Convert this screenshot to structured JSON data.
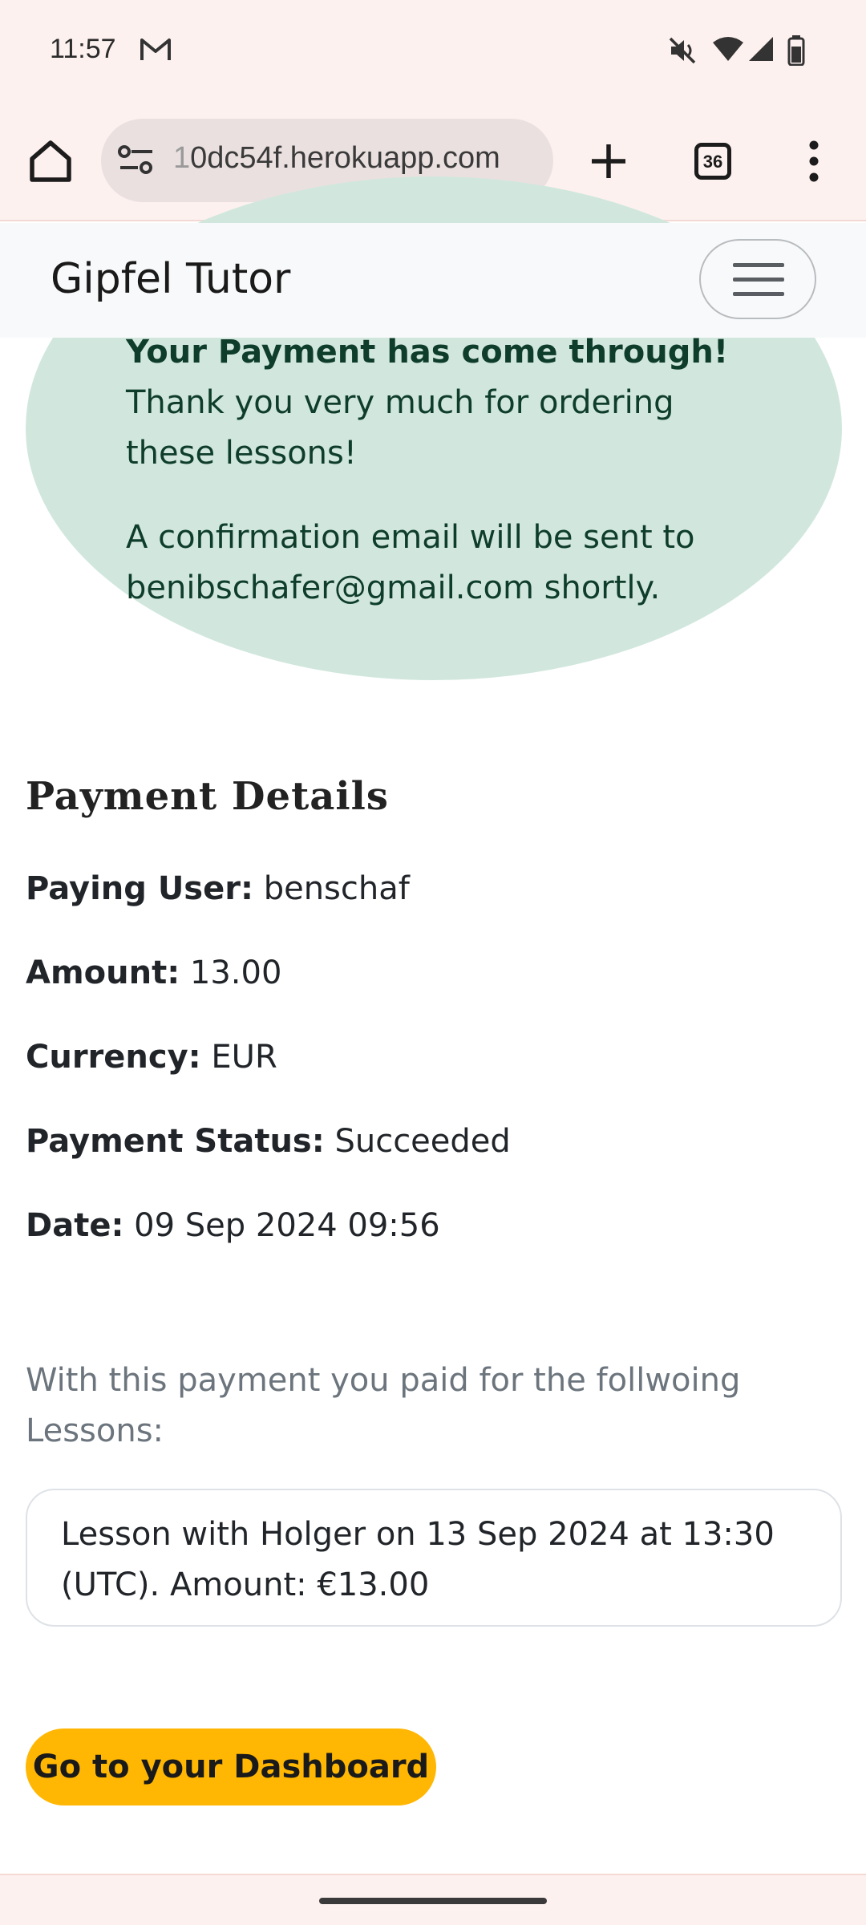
{
  "status_bar": {
    "time": "11:57",
    "icons": [
      "gmail-icon",
      "mute-icon",
      "wifi-icon",
      "signal-icon",
      "battery-icon"
    ]
  },
  "browser": {
    "url_prefix": "1",
    "url_main": "0dc54f.herokuapp.com",
    "tab_count": "36",
    "icons": [
      "home-icon",
      "site-info-icon",
      "new-tab-icon",
      "tab-switcher-icon",
      "more-icon"
    ]
  },
  "navbar": {
    "brand": "Gipfel Tutor"
  },
  "alert": {
    "heading": "Your Payment has come through!",
    "message": "Thank you very much for ordering these lessons!",
    "email_note": "A confirmation email will be sent to benibschafer@gmail.com shortly."
  },
  "details": {
    "title": "Payment Details",
    "paying_user_label": "Paying User:",
    "paying_user": "benschaf",
    "amount_label": "Amount:",
    "amount": "13.00",
    "currency_label": "Currency:",
    "currency": "EUR",
    "status_label": "Payment Status:",
    "status": "Succeeded",
    "date_label": "Date:",
    "date": "09 Sep 2024 09:56"
  },
  "lessons": {
    "intro": "With this payment you paid for the follwoing Lessons:",
    "items": [
      "Lesson with Holger on 13 Sep 2024 at 13:30 (UTC). Amount: €13.00"
    ]
  },
  "actions": {
    "dashboard_button": "Go to your Dashboard"
  },
  "colors": {
    "alert_bg": "#d1e7dd",
    "button_bg": "#ffb703",
    "browser_chrome": "#fdf1ef"
  }
}
